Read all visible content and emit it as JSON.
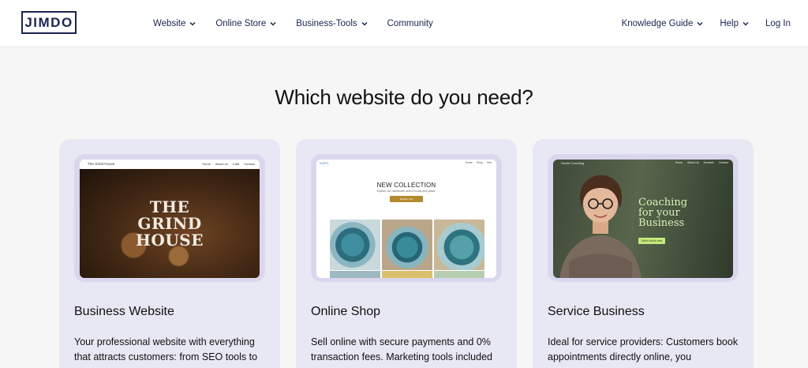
{
  "header": {
    "logo": "JIMDO",
    "nav_left": [
      {
        "label": "Website",
        "has_menu": true
      },
      {
        "label": "Online Store",
        "has_menu": true
      },
      {
        "label": "Business-Tools",
        "has_menu": true
      },
      {
        "label": "Community",
        "has_menu": false
      }
    ],
    "nav_right": [
      {
        "label": "Knowledge Guide",
        "has_menu": true
      },
      {
        "label": "Help",
        "has_menu": true
      },
      {
        "label": "Log In",
        "has_menu": false
      }
    ]
  },
  "main": {
    "title": "Which website do you need?",
    "cards": [
      {
        "title": "Business Website",
        "description": "Your professional website with everything that attracts customers: from SEO tools to",
        "preview": {
          "site_name": "The Grind House",
          "nav": [
            "Home",
            "About us",
            "Café",
            "Contact"
          ],
          "hero_lines": [
            "THE",
            "GRIND",
            "HOUSE"
          ]
        }
      },
      {
        "title": "Online Shop",
        "description": "Sell online with secure payments and 0% transaction fees. Marketing tools included",
        "preview": {
          "site_name": "KÚPO",
          "nav": [
            "Home",
            "Shop",
            "Info"
          ],
          "heading": "NEW COLLECTION",
          "subheading": "Explore our handmade sets of bowls and plates.",
          "button": "Explore now"
        }
      },
      {
        "title": "Service Business",
        "description": "Ideal for service providers: Customers book appointments directly online, you",
        "preview": {
          "site_name": "Nicole Coaching",
          "nav": [
            "Home",
            "About Us",
            "Services",
            "Contact"
          ],
          "heading_lines": [
            "Coaching",
            "for your",
            "Business"
          ],
          "button": "Get in touch now"
        }
      }
    ]
  },
  "colors": {
    "nav_text": "#1a2550",
    "card_bg": "#e8e7f4",
    "page_bg": "#f6f6f6",
    "coffee_dark": "#3f2613",
    "shop_accent": "#b38b2f",
    "coach_green": "#c6ea7a"
  }
}
